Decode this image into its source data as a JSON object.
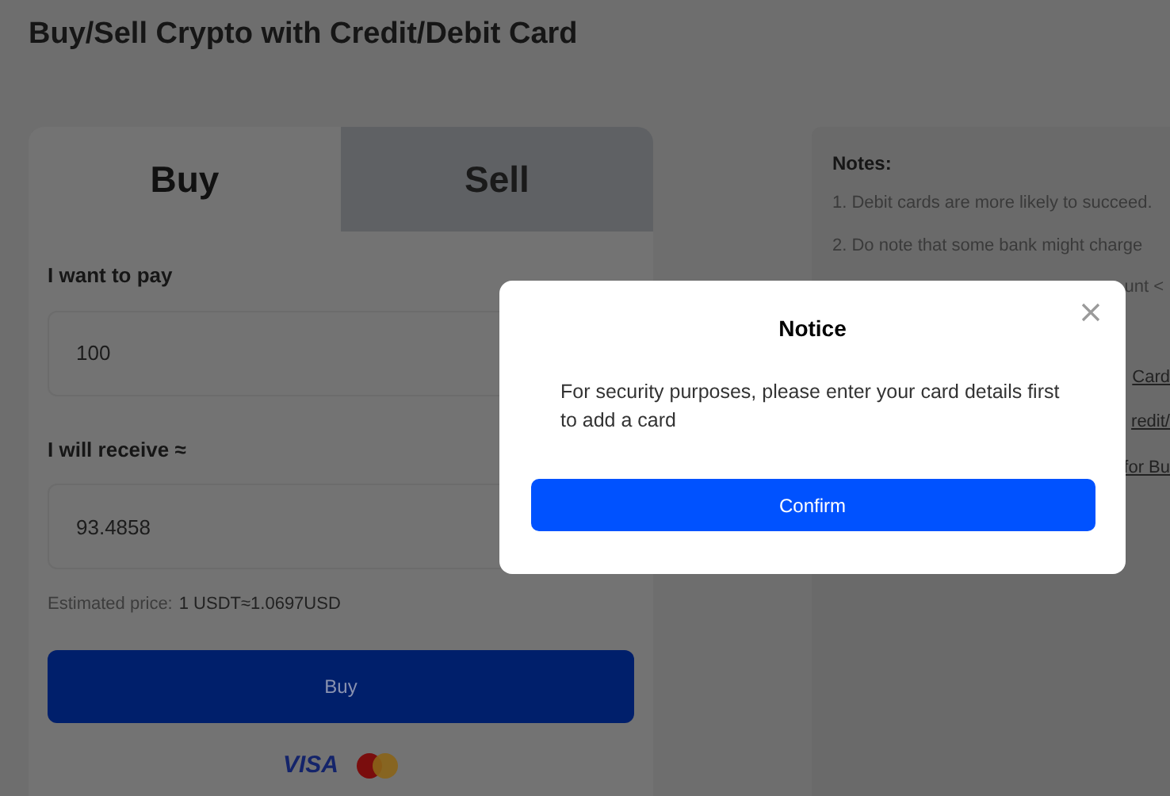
{
  "page": {
    "title": "Buy/Sell Crypto with Credit/Debit Card"
  },
  "tabs": [
    {
      "label": "Buy",
      "selected": true
    },
    {
      "label": "Sell",
      "selected": false
    }
  ],
  "pay": {
    "label": "I want to pay",
    "value": "100"
  },
  "receive": {
    "label": "I will receive ≈",
    "value": "93.4858"
  },
  "estimate": {
    "label": "Estimated price:",
    "value": "1 USDT≈1.0697USD"
  },
  "buy_button": "Buy",
  "card_brand": "VISA",
  "notes": {
    "title": "Notes:",
    "items": [
      "1. Debit cards are more likely to succeed.",
      "2. Do note that some bank might charge",
      "unt <"
    ],
    "links": [
      "Card",
      "redit/",
      "for Bu"
    ]
  },
  "dialog": {
    "title": "Notice",
    "message": "For security purposes, please enter your card details first to add a card",
    "button": "Confirm"
  }
}
